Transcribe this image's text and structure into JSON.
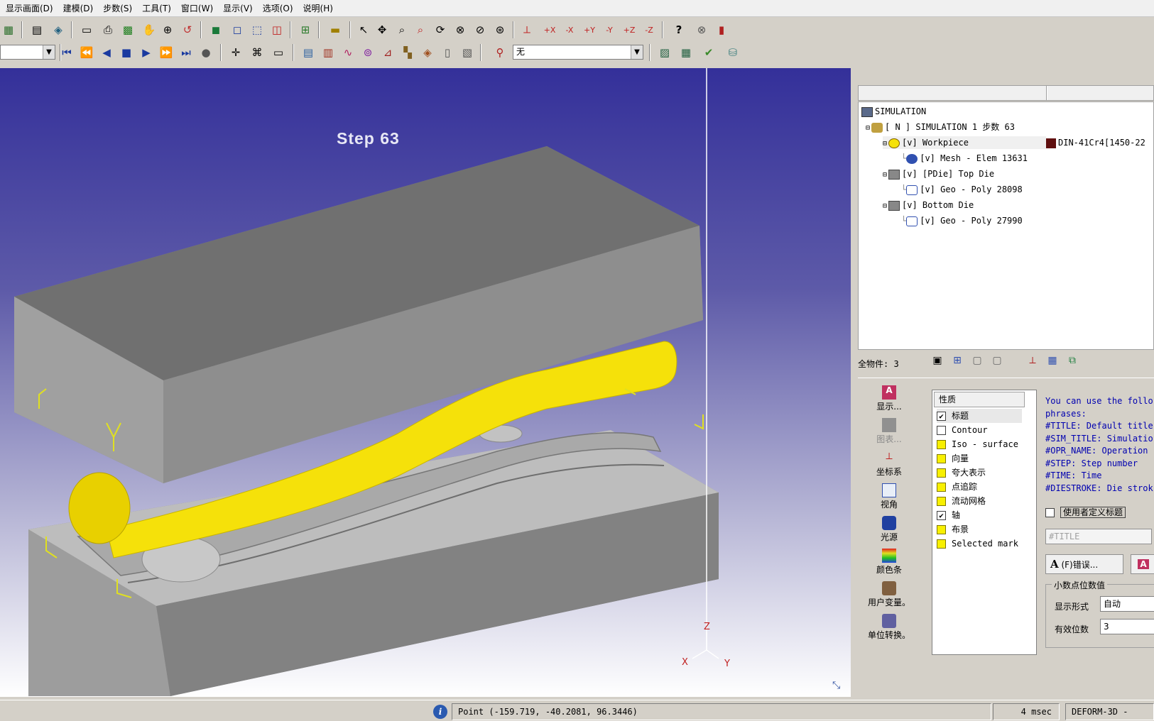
{
  "menu": [
    "显示画面(D)",
    "建模(D)",
    "步数(S)",
    "工具(T)",
    "窗口(W)",
    "显示(V)",
    "选项(O)",
    "说明(H)"
  ],
  "toolbar": {
    "step_combo_value": "",
    "display_combo_value": "无"
  },
  "viewport": {
    "step_label": "Step   63",
    "axis": {
      "z": "Z",
      "x": "X",
      "y": "Y"
    },
    "workpiece_color": "#f5e10a",
    "die_color": "#8c8c8c"
  },
  "tree": {
    "root": "SIMULATION",
    "sim": "[ N ]  SIMULATION 1  步数 63",
    "workpiece": "[v] Workpiece",
    "material": "DIN-41Cr4[1450-22",
    "mesh": "[v] Mesh - Elem 13631",
    "topdie": "[v] [PDie] Top Die",
    "topgeo": "[v] Geo - Poly 28098",
    "bottomdie": "[v] Bottom Die",
    "bottomgeo": "[v] Geo - Poly 27990"
  },
  "object_count": "全物件: 3",
  "side_buttons": [
    "显示...",
    "图表...",
    "坐标系",
    "视角",
    "光源",
    "颜色条",
    "用户变量。",
    "单位转换。"
  ],
  "properties": {
    "header": "性质",
    "items": [
      {
        "label": "标题",
        "checked": true,
        "style": "box"
      },
      {
        "label": "Contour",
        "checked": false,
        "style": "box"
      },
      {
        "label": "Iso - surface",
        "checked": false,
        "style": "yellow"
      },
      {
        "label": "向量",
        "checked": false,
        "style": "yellow"
      },
      {
        "label": "夸大表示",
        "checked": false,
        "style": "yellow"
      },
      {
        "label": "点追踪",
        "checked": false,
        "style": "yellow"
      },
      {
        "label": "流动网格",
        "checked": false,
        "style": "yellow"
      },
      {
        "label": "轴",
        "checked": true,
        "style": "box"
      },
      {
        "label": "布景",
        "checked": false,
        "style": "yellow"
      },
      {
        "label": "Selected mark",
        "checked": false,
        "style": "yellow"
      }
    ]
  },
  "help_text": [
    "You can use the follo",
    "phrases:",
    "#TITLE: Default title",
    "#SIM_TITLE: Simulatio",
    "#OPR_NAME: Operation",
    "#STEP: Step number",
    "#TIME: Time",
    "#DIESTROKE: Die strok"
  ],
  "title_options": {
    "custom_title_label": "使用者定义标题",
    "title_placeholder": "#TITLE",
    "font_button": "(F)错误...",
    "decimal_group": "小数点位数值",
    "display_format_label": "显示形式",
    "display_format_value": "自动",
    "significant_digits_label": "有效位数",
    "significant_digits_value": "3"
  },
  "status": {
    "point": "Point (-159.719, -40.2081, 96.3446)",
    "time": "4 msec",
    "app": "DEFORM-3D  -"
  }
}
